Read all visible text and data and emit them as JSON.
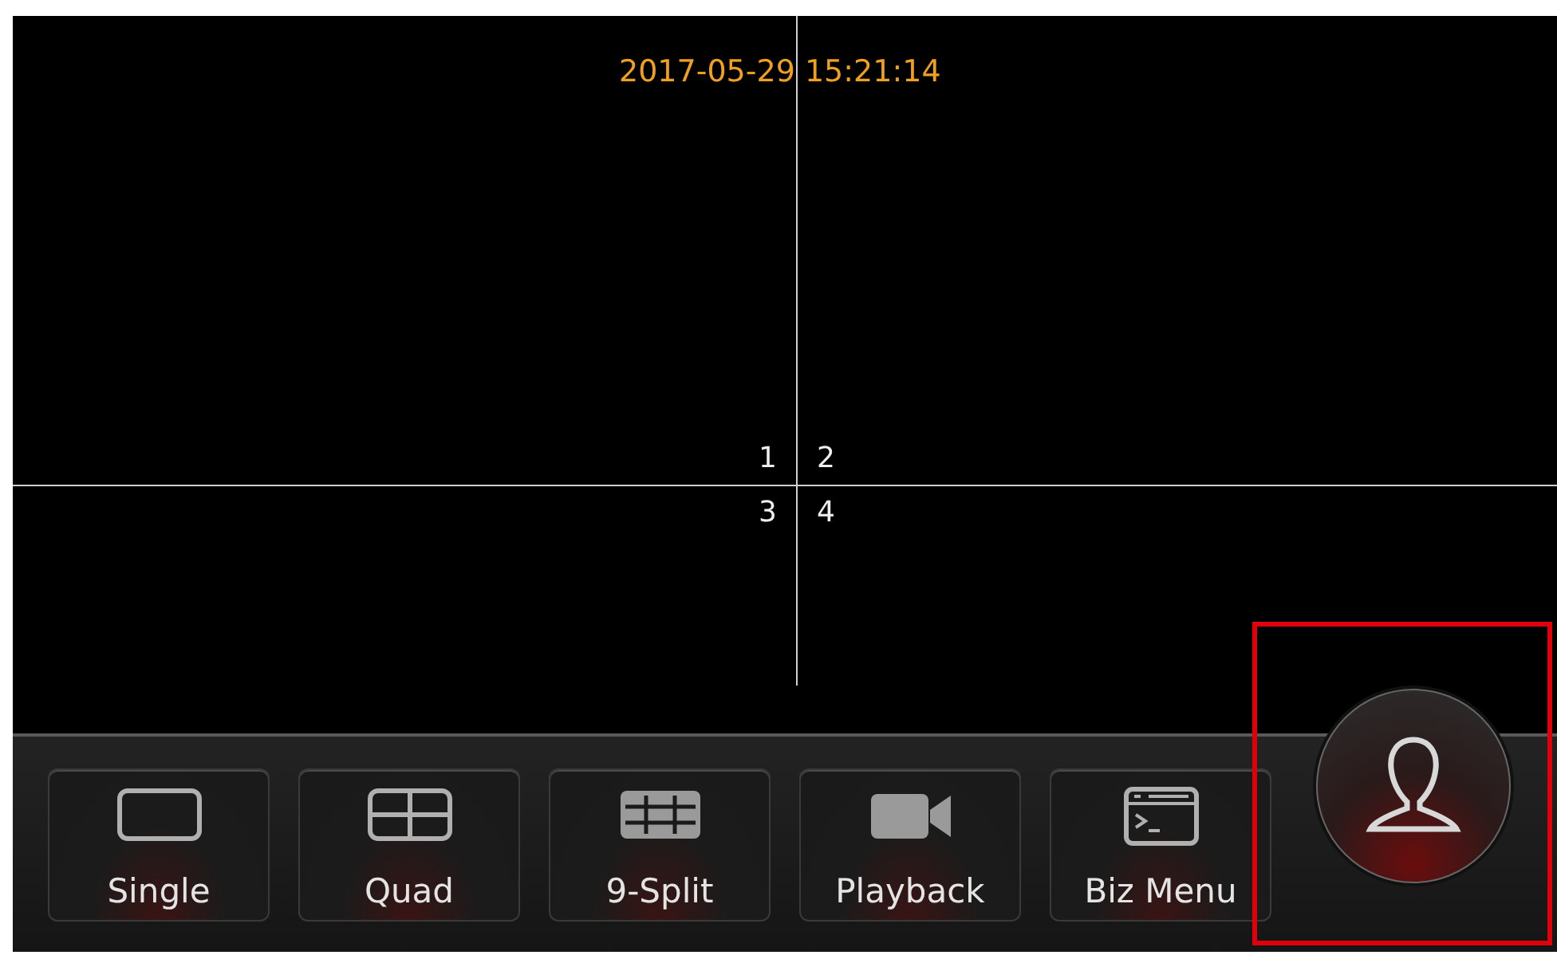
{
  "timestamp": "2017-05-29 15:21:14",
  "channels": [
    {
      "label": "1"
    },
    {
      "label": "2"
    },
    {
      "label": "3"
    },
    {
      "label": "4"
    }
  ],
  "toolbar": [
    {
      "kind": "single",
      "label": "Single"
    },
    {
      "kind": "quad",
      "label": "Quad"
    },
    {
      "kind": "split9",
      "label": "9-Split"
    },
    {
      "kind": "playback",
      "label": "Playback"
    },
    {
      "kind": "menu",
      "label": "Biz Menu"
    }
  ],
  "user_button": {
    "highlighted": true
  }
}
